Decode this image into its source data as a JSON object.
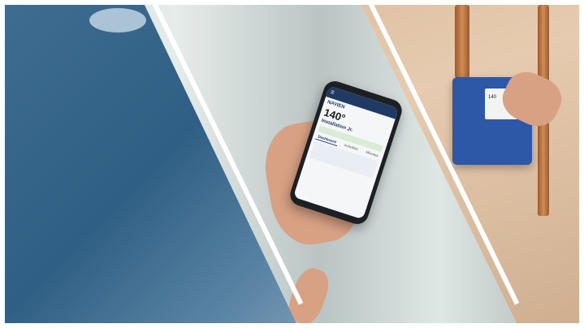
{
  "colors": {
    "shower_blue": "#2f5f84",
    "app_navy": "#1f3b63",
    "control_blue": "#2d58a8",
    "copper": "#c67d45"
  },
  "phone_app": {
    "brand": "NAVIEN",
    "temperature": "140°",
    "device_name": "Installation Jr.",
    "tabs": [
      "Dashboard",
      "Activities",
      "Minutes"
    ],
    "active_tab": "Dashboard"
  },
  "control_unit": {
    "display_values": [
      "140",
      "140"
    ]
  }
}
